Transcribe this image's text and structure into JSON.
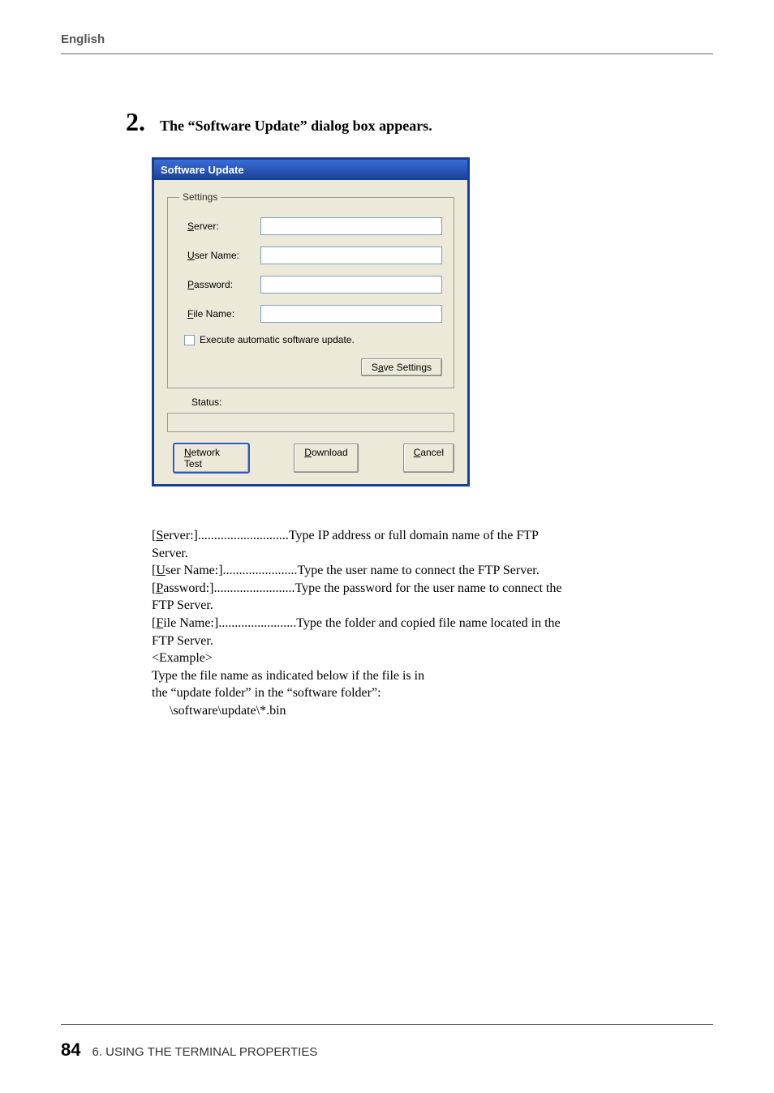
{
  "header": {
    "lang": "English"
  },
  "step": {
    "number": "2.",
    "text": "The “Software Update” dialog box appears."
  },
  "dialog": {
    "title": "Software Update",
    "settings_legend": "Settings",
    "labels": {
      "server": "erver:",
      "server_u": "S",
      "user": "ser Name:",
      "user_u": "U",
      "password": "assword:",
      "password_u": "P",
      "file": "ile Name:",
      "file_u": "F"
    },
    "checkbox_u": "E",
    "checkbox_rest": "xecute automatic software update.",
    "save_u": "a",
    "save_pre": "S",
    "save_post": "ve Settings",
    "status_label": "Status:",
    "nettest_u": "N",
    "nettest_rest": "etwork Test",
    "download_u": "D",
    "download_rest": "ownload",
    "cancel_u": "C",
    "cancel_rest": "ancel"
  },
  "definitions": {
    "server_term_u": "S",
    "server_term_rest": "erver:]",
    "server_term_pre": "[",
    "server_dots": " ............................",
    "server_desc1": "Type IP address or full domain name of the FTP",
    "server_desc2": "Server.",
    "user_term_u": "U",
    "user_term_rest": "ser Name:]",
    "user_term_pre": "[",
    "user_dots": ".......................",
    "user_desc": "Type the user name to connect the FTP Server.",
    "password_term_u": "P",
    "password_term_rest": "assword:]",
    "password_term_pre": "[",
    "password_dots": " .........................",
    "password_desc1": "Type the password for the user name to connect the",
    "password_desc2": "FTP Server.",
    "file_term_u": "F",
    "file_term_rest": "ile Name:]",
    "file_term_pre": "[",
    "file_dots": "........................",
    "file_desc1": "Type the folder and copied file name located in the",
    "file_desc2": "FTP Server.",
    "file_example": "<Example>",
    "file_desc3": "Type the file name as indicated below if the file is in",
    "file_desc4": "the “update folder” in the “software folder”:",
    "file_desc5": "\\software\\update\\*.bin"
  },
  "footer": {
    "page": "84",
    "chapter": "6. USING THE TERMINAL PROPERTIES"
  }
}
